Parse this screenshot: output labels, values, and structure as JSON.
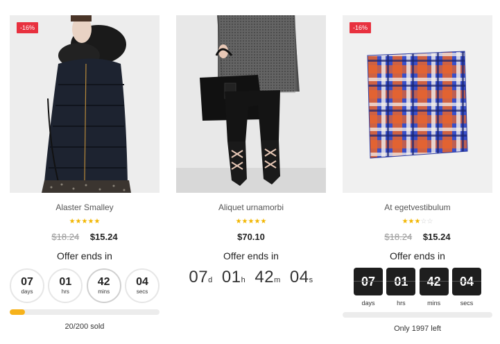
{
  "products": [
    {
      "badge": "-16%",
      "title": "Alaster Smalley",
      "rating": 5,
      "old_price": "$18.24",
      "new_price": "$15.24",
      "offer": "Offer ends in",
      "countdown": [
        {
          "value": "07",
          "label": "days"
        },
        {
          "value": "01",
          "label": "hrs"
        },
        {
          "value": "42",
          "label": "mins"
        },
        {
          "value": "04",
          "label": "secs"
        }
      ],
      "progress": 0.1,
      "stock_text": "20/200 sold"
    },
    {
      "title": "Aliquet urnamorbi",
      "rating": 5,
      "new_price": "$70.10",
      "offer": "Offer ends in",
      "countdown": [
        {
          "value": "07",
          "unit": "d"
        },
        {
          "value": "01",
          "unit": "h"
        },
        {
          "value": "42",
          "unit": "m"
        },
        {
          "value": "04",
          "unit": "s"
        }
      ]
    },
    {
      "badge": "-16%",
      "title": "At egetvestibulum",
      "rating": 3,
      "old_price": "$18.24",
      "new_price": "$15.24",
      "offer": "Offer ends in",
      "countdown": [
        {
          "value": "07",
          "label": "days"
        },
        {
          "value": "01",
          "label": "hrs"
        },
        {
          "value": "42",
          "label": "mins"
        },
        {
          "value": "04",
          "label": "secs"
        }
      ],
      "progress": 0,
      "stock_text": "Only 1997 left"
    }
  ],
  "colors": {
    "badge": "#e8313f",
    "star": "#f2b600",
    "progress": "#f6b21b",
    "flip_box": "#1e1e1e"
  }
}
